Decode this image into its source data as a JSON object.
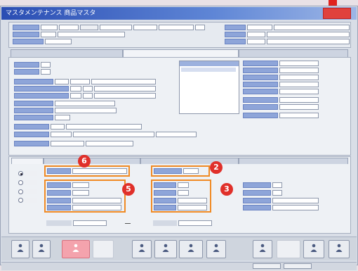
{
  "window": {
    "title": "マスタメンテナンス 商品マスタ",
    "close_label": ""
  },
  "markers": {
    "m6": "6",
    "m2": "2",
    "m5": "5",
    "m3": "3"
  },
  "colors": {
    "title_bar": "#2a4db3",
    "marker": "#e0302a",
    "highlight_border": "#f08a24",
    "label_fill": "#8ea5d9",
    "active_button": "#f4a3ad"
  },
  "icons": {
    "toolbar_button_icon": "person-icon"
  }
}
